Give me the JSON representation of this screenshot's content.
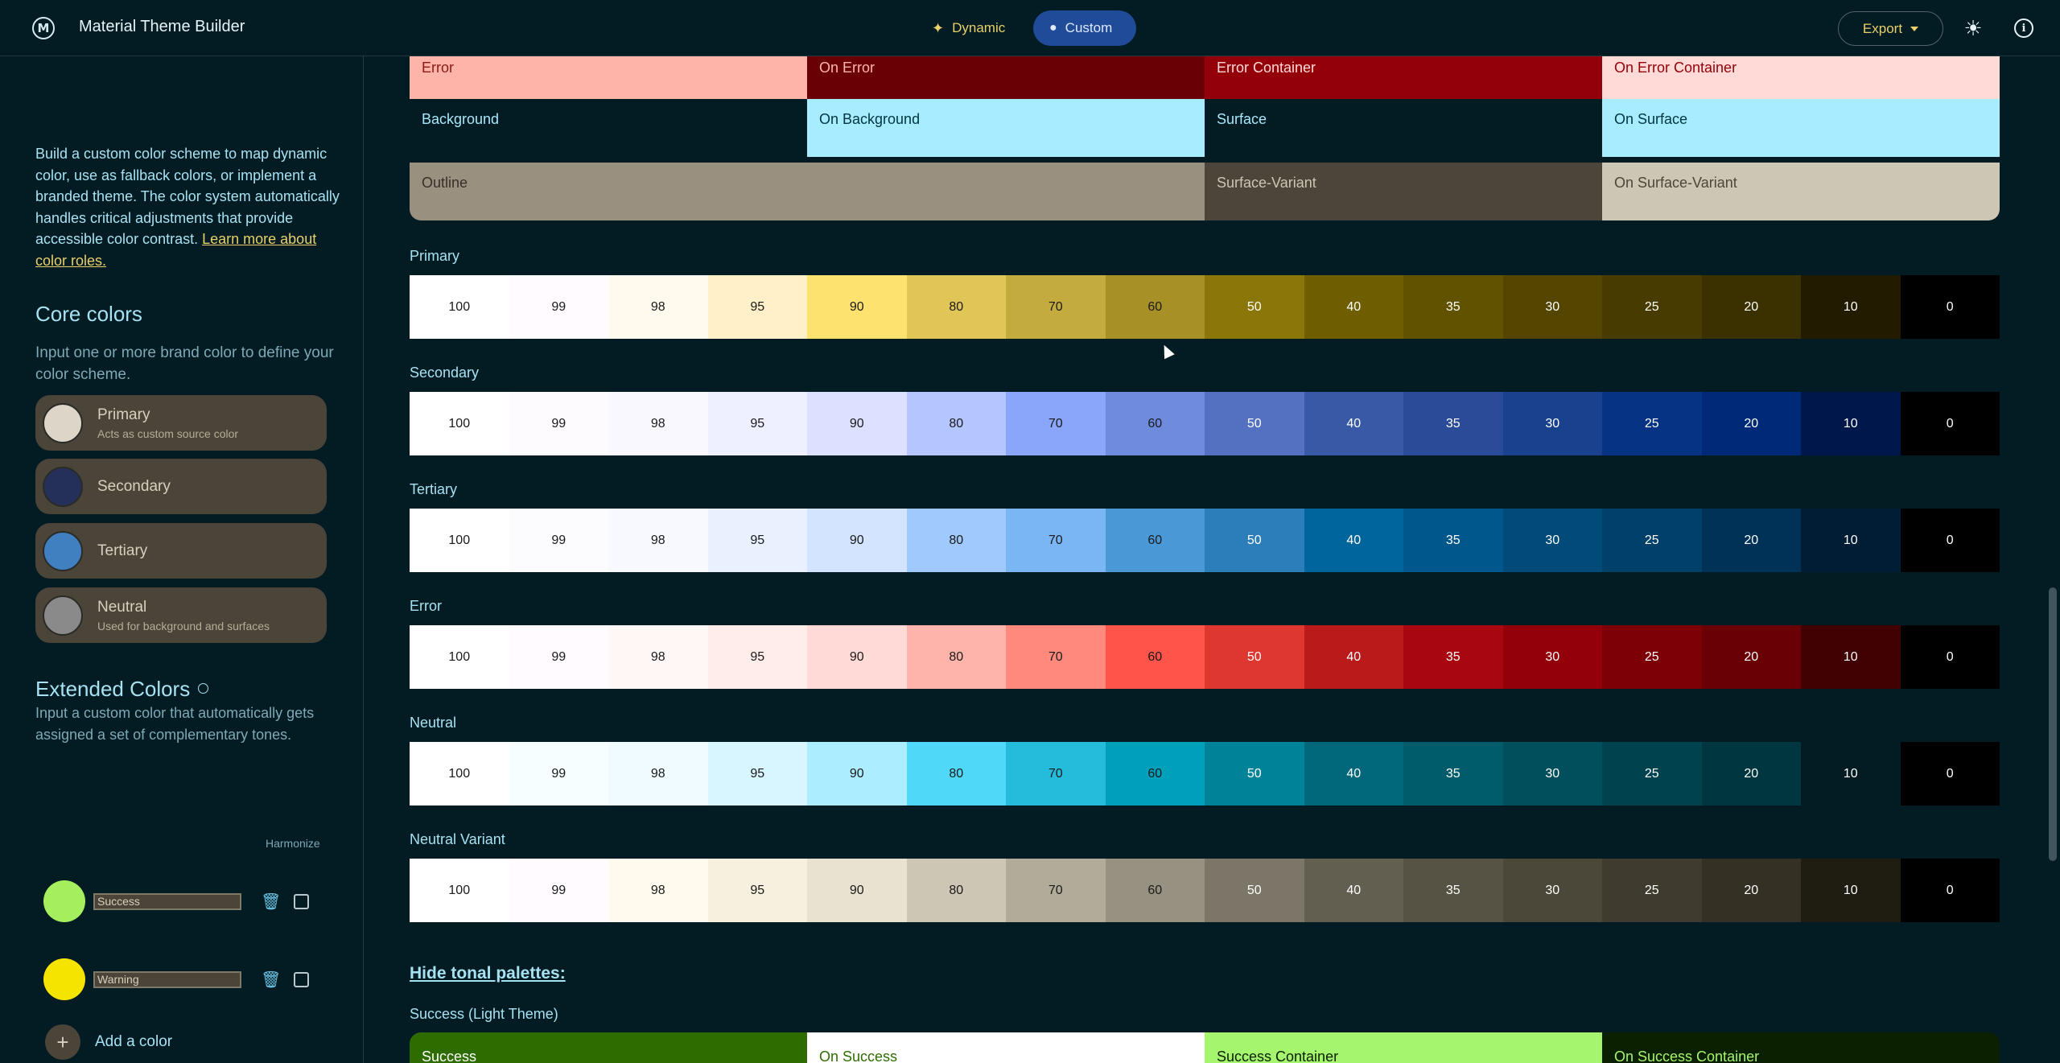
{
  "header": {
    "logo": "M",
    "title": "Material Theme Builder",
    "dynamic_label": "Dynamic",
    "custom_label": "Custom",
    "export_label": "Export",
    "colors": {
      "accent_yellow": "#e8d06a",
      "selected_bg": "#1f4b99"
    }
  },
  "sidebar": {
    "intro_text": "Build a custom color scheme to map dynamic color, use as fallback colors, or implement a branded theme. The color system automatically handles critical adjustments that provide accessible color contrast.",
    "intro_link": "Learn more about color roles.",
    "core_title": "Core colors",
    "core_sub": "Input one or more brand color to define your color scheme.",
    "core_items": [
      {
        "name": "Primary",
        "desc": "Acts as custom source color",
        "color": "#ddd6c8"
      },
      {
        "name": "Secondary",
        "desc": "",
        "color": "#25305a"
      },
      {
        "name": "Tertiary",
        "desc": "",
        "color": "#4180c0"
      },
      {
        "name": "Neutral",
        "desc": "Used for background and surfaces",
        "color": "#8a8a8a"
      }
    ],
    "extended_title": "Extended Colors",
    "extended_sub": "Input a custom color that automatically gets assigned a set of complementary tones.",
    "harmonize_label": "Harmonize",
    "extended_items": [
      {
        "value": "Success",
        "color": "#a5ef5e"
      },
      {
        "value": "Warning",
        "color": "#f5e400"
      }
    ],
    "add_label": "Add a color"
  },
  "scheme_rows": [
    [
      {
        "label": "Error",
        "bg": "#ffb4aa",
        "fg": "#8a1a14"
      },
      {
        "label": "On Error",
        "bg": "#690005",
        "fg": "#ffb4aa"
      },
      {
        "label": "Error Container",
        "bg": "#93000a",
        "fg": "#ffdad6"
      },
      {
        "label": "On Error Container",
        "bg": "#ffdad6",
        "fg": "#93000a"
      }
    ],
    [
      {
        "label": "Background",
        "bg": "#031b22",
        "fg": "#a7e9fb"
      },
      {
        "label": "On Background",
        "bg": "#a7ecff",
        "fg": "#00363f"
      },
      {
        "label": "Surface",
        "bg": "#031b22",
        "fg": "#a7e9fb"
      },
      {
        "label": "On Surface",
        "bg": "#a7ecff",
        "fg": "#00363f"
      }
    ],
    [
      {
        "label": "Outline",
        "bg": "#999080",
        "fg": "#36302a",
        "span": 2
      },
      {
        "label": "Surface-Variant",
        "bg": "#4b4639",
        "fg": "#ccc5b4"
      },
      {
        "label": "On Surface-Variant",
        "bg": "#cdc6b4",
        "fg": "#4b4639"
      }
    ]
  ],
  "tones": [
    "100",
    "99",
    "98",
    "95",
    "90",
    "80",
    "70",
    "60",
    "50",
    "40",
    "35",
    "30",
    "25",
    "20",
    "10",
    "0"
  ],
  "palettes": [
    {
      "name": "Primary",
      "colors": [
        "#ffffff",
        "#fffbff",
        "#fff9ee",
        "#fff0c7",
        "#fde26f",
        "#e0c656",
        "#c3ab3d",
        "#a79025",
        "#8b7709",
        "#6f5e00",
        "#615200",
        "#544600",
        "#473b00",
        "#3a3000",
        "#221b00",
        "#000000"
      ]
    },
    {
      "name": "Secondary",
      "colors": [
        "#ffffff",
        "#fefbff",
        "#faf8ff",
        "#eef0ff",
        "#dbe1ff",
        "#b4c5ff",
        "#8aa6fb",
        "#6e8bdd",
        "#5371c0",
        "#3859a5",
        "#2a4c98",
        "#1a418e",
        "#063383",
        "#002a78",
        "#00174b",
        "#000000"
      ]
    },
    {
      "name": "Tertiary",
      "colors": [
        "#ffffff",
        "#fcfcff",
        "#f7f9ff",
        "#e9f1ff",
        "#d2e4ff",
        "#a0cafd",
        "#7ab5f4",
        "#4b98d7",
        "#2c7ebb",
        "#00649d",
        "#00578b",
        "#004b7a",
        "#004069",
        "#003258",
        "#001d36",
        "#000000"
      ]
    },
    {
      "name": "Error",
      "colors": [
        "#ffffff",
        "#fffbff",
        "#fff8f7",
        "#ffedea",
        "#ffdad6",
        "#ffb4ab",
        "#ff897d",
        "#ff5449",
        "#de3730",
        "#ba1a1a",
        "#a80710",
        "#93000a",
        "#7e0007",
        "#690005",
        "#410002",
        "#000000"
      ]
    },
    {
      "name": "Neutral",
      "colors": [
        "#ffffff",
        "#f6feff",
        "#effbff",
        "#d8f6ff",
        "#acedff",
        "#4fd8f7",
        "#24bcda",
        "#00a0bb",
        "#008399",
        "#00687a",
        "#005b6b",
        "#004f5d",
        "#00434f",
        "#003640",
        "#031b22",
        "#000000"
      ]
    },
    {
      "name": "Neutral Variant",
      "colors": [
        "#ffffff",
        "#fffbff",
        "#fff9ee",
        "#f8f0de",
        "#e9e2d0",
        "#cdc6b4",
        "#b1ab9a",
        "#969180",
        "#7b7667",
        "#625e50",
        "#565345",
        "#4b4739",
        "#3f3b2e",
        "#343024",
        "#1f1c12",
        "#000000"
      ]
    }
  ],
  "hide_link": "Hide tonal palettes:",
  "success_label": "Success (Light Theme)",
  "success_row": [
    {
      "label": "Success",
      "bg": "#2e6c00",
      "fg": "#ffffff"
    },
    {
      "label": "On Success",
      "bg": "#ffffff",
      "fg": "#2e6c00"
    },
    {
      "label": "Success Container",
      "bg": "#a5f56e",
      "fg": "#0b2000"
    },
    {
      "label": "On Success Container",
      "bg": "#0b2000",
      "fg": "#a5f56e"
    }
  ]
}
